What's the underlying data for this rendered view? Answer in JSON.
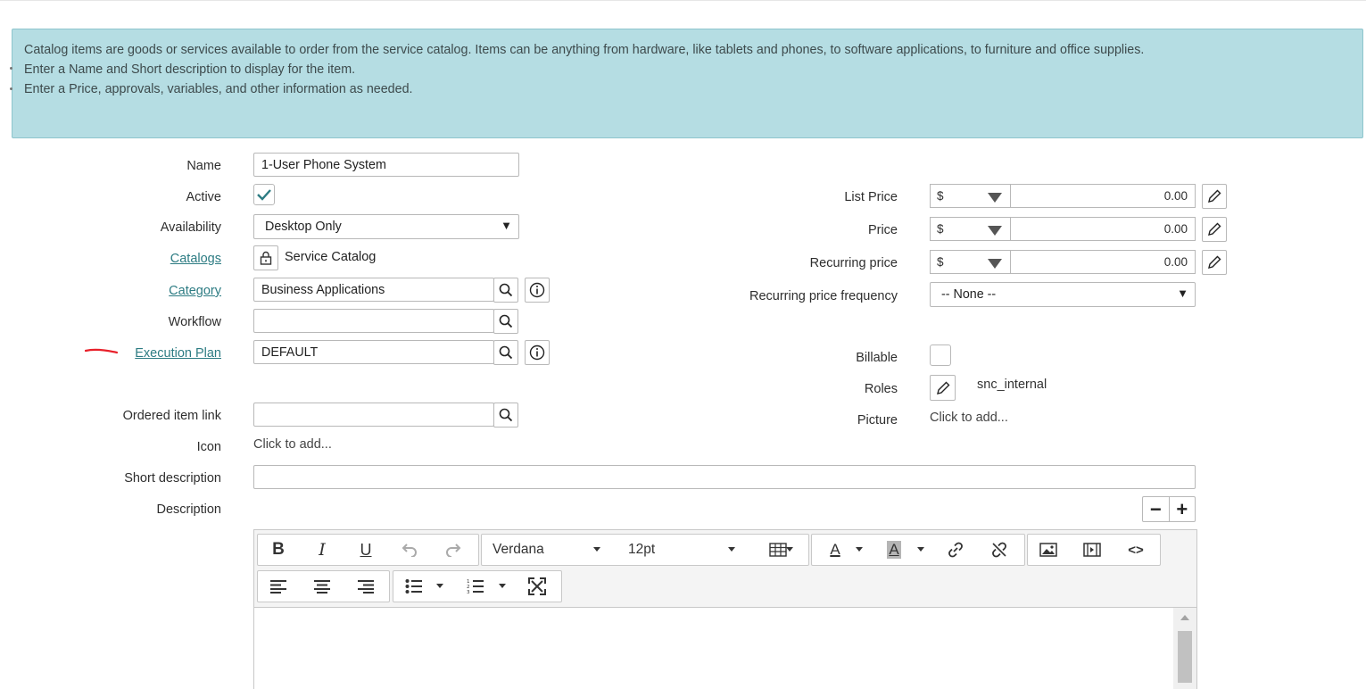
{
  "banner": {
    "line1": "Catalog items are goods or services available to order from the service catalog. Items can be anything from hardware, like tablets and phones, to software applications, to furniture and office supplies.",
    "line2": "Enter a Name and Short description to display for the item.",
    "line3": "Enter a Price, approvals, variables, and other information as needed."
  },
  "left": {
    "name_label": "Name",
    "name_value": "1-User Phone System",
    "active_label": "Active",
    "active_checked": true,
    "availability_label": "Availability",
    "availability_value": "Desktop Only",
    "catalogs_label": "Catalogs",
    "catalogs_value": "Service Catalog",
    "category_label": "Category",
    "category_value": "Business Applications",
    "workflow_label": "Workflow",
    "workflow_value": "",
    "execution_plan_label": "Execution Plan",
    "execution_plan_value": "DEFAULT",
    "ordered_item_link_label": "Ordered item link",
    "ordered_item_link_value": "",
    "icon_label": "Icon",
    "icon_value": "Click to add...",
    "short_description_label": "Short description",
    "short_description_value": "",
    "description_label": "Description"
  },
  "right": {
    "list_price_label": "List Price",
    "list_price_currency": "$",
    "list_price_amount": "0.00",
    "price_label": "Price",
    "price_currency": "$",
    "price_amount": "0.00",
    "recurring_price_label": "Recurring price",
    "recurring_price_currency": "$",
    "recurring_price_amount": "0.00",
    "recurring_frequency_label": "Recurring price frequency",
    "recurring_frequency_value": "-- None --",
    "billable_label": "Billable",
    "billable_checked": false,
    "roles_label": "Roles",
    "roles_value": "snc_internal",
    "picture_label": "Picture",
    "picture_value": "Click to add..."
  },
  "editor": {
    "font_family": "Verdana",
    "font_size": "12pt",
    "bold_label": "B",
    "italic_label": "I",
    "underline_label": "U",
    "text_color_label": "A",
    "bg_color_label": "A",
    "source_label": "<>"
  },
  "icons": {
    "search": "search-icon",
    "info": "info-icon",
    "lock": "lock-icon",
    "pencil": "pencil-icon"
  },
  "colors": {
    "banner_bg": "#b5dde3",
    "link": "#2d7c83",
    "check": "#2d7c83",
    "annotation": "#e8202a"
  }
}
